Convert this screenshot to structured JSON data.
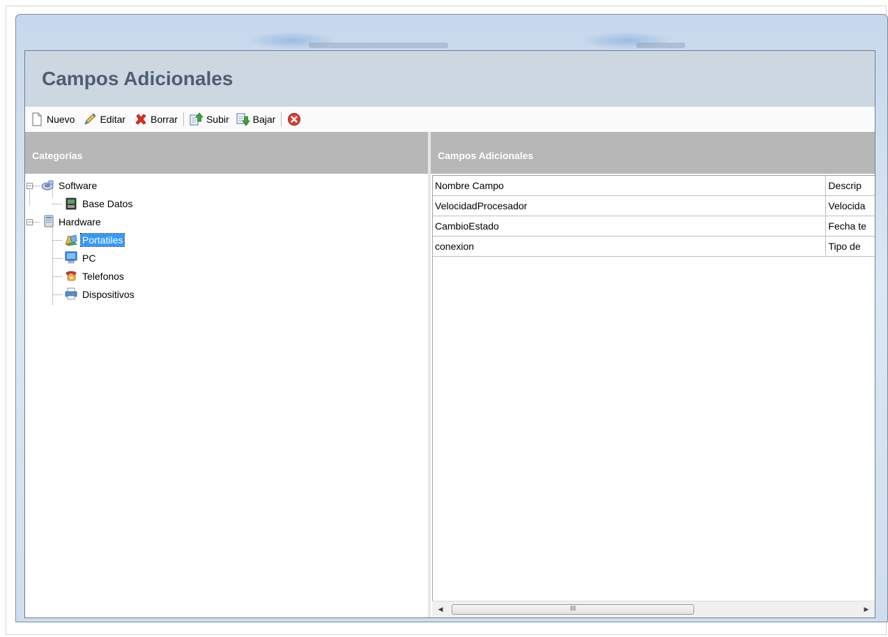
{
  "window": {
    "title": "Campos Adicionales"
  },
  "toolbar": {
    "nuevo_label": "Nuevo",
    "editar_label": "Editar",
    "borrar_label": "Borrar",
    "subir_label": "Subir",
    "bajar_label": "Bajar",
    "icons": [
      "new-document-icon",
      "pencil-icon",
      "red-x-icon",
      "move-up-icon",
      "move-down-icon",
      "close-circle-icon"
    ]
  },
  "left_panel": {
    "header": "Categorías",
    "tree": {
      "software": {
        "label": "Software",
        "icon": "software-icon",
        "expanded": true
      },
      "base_datos": {
        "label": "Base Datos",
        "icon": "database-icon"
      },
      "hardware": {
        "label": "Hardware",
        "icon": "hardware-icon",
        "expanded": true
      },
      "portatiles": {
        "label": "Portatiles",
        "icon": "laptop-icon",
        "selected": true
      },
      "pc": {
        "label": "PC",
        "icon": "monitor-icon"
      },
      "telefonos": {
        "label": "Telefonos",
        "icon": "telephone-icon"
      },
      "dispositivos": {
        "label": "Dispositivos",
        "icon": "printer-icon"
      }
    }
  },
  "right_panel": {
    "header": "Campos Adicionales",
    "columns": [
      "Nombre Campo",
      "Descripción"
    ],
    "visible_columns": [
      "Nombre Campo",
      "Descrip"
    ],
    "rows": [
      [
        "VelocidadProcesador",
        "Velocida"
      ],
      [
        "CambioEstado",
        "Fecha te"
      ],
      [
        "conexion",
        "Tipo de"
      ]
    ],
    "scrollbar": {
      "thumb_grip": "III",
      "left_arrow": "◀",
      "right_arrow": "▶"
    }
  },
  "colors": {
    "header_band": "#cdd7e1",
    "title_text": "#4e5e70",
    "panel_header": "#b7b7b7",
    "selection": "#3399ff"
  }
}
